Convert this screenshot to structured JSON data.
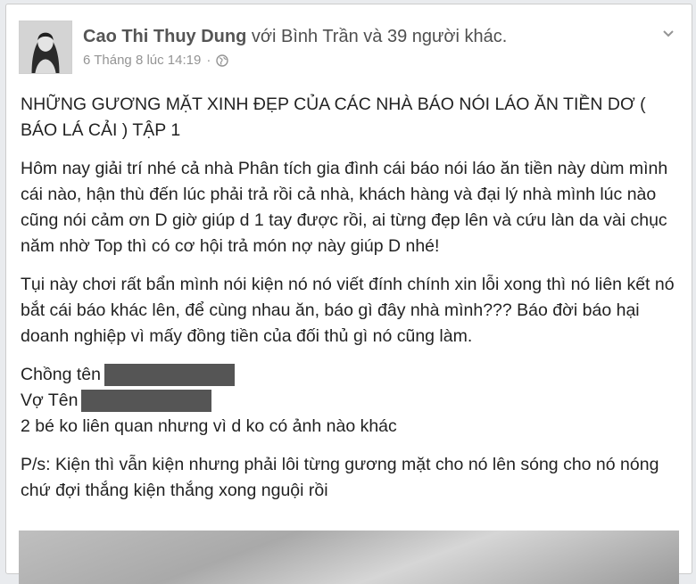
{
  "post": {
    "author": "Cao Thi Thuy Dung",
    "with_text": "với Bình Trần và 39 người khác.",
    "timestamp": "6 Tháng 8 lúc 14:19",
    "separator": "·",
    "privacy_icon": "globe-icon",
    "menu_icon": "chevron-down-icon",
    "title_line": "NHỮNG GƯƠNG MẶT XINH ĐẸP CỦA CÁC NHÀ BÁO NÓI LÁO ĂN TIỀN DƠ ( BÁO LÁ CẢI ) TẬP 1",
    "paragraph1": "Hôm nay giải trí nhé cả nhà Phân tích gia đình cái báo nói láo ăn tiền này dùm mình cái nào, hận thù đến lúc phải trả rồi cả nhà, khách hàng và đại lý nhà mình lúc nào cũng nói cảm ơn D giờ giúp d 1 tay được rồi, ai từng đẹp lên và cứu làn da vài chục năm nhờ Top thì có cơ hội trả món nợ này giúp D nhé!",
    "paragraph2": "Tụi này chơi rất bẩn mình nói kiện nó nó viết đính chính xin lỗi xong thì nó liên kết nó bắt cái báo khác lên, để cùng nhau ăn, báo gì đây nhà mình??? Báo đời báo hại doanh nghiệp vì mấy đồng tiền của đối thủ gì nó cũng làm.",
    "husband_label": "Chồng tên",
    "wife_label": "Vợ Tên",
    "kids_line": "2 bé ko liên quan nhưng vì d ko có ảnh nào khác",
    "ps_line": "P/s: Kiện thì vẫn kiện nhưng phải lôi từng gương mặt cho nó lên sóng cho nó nóng chứ đợi thắng kiện thắng xong nguội rồi"
  }
}
